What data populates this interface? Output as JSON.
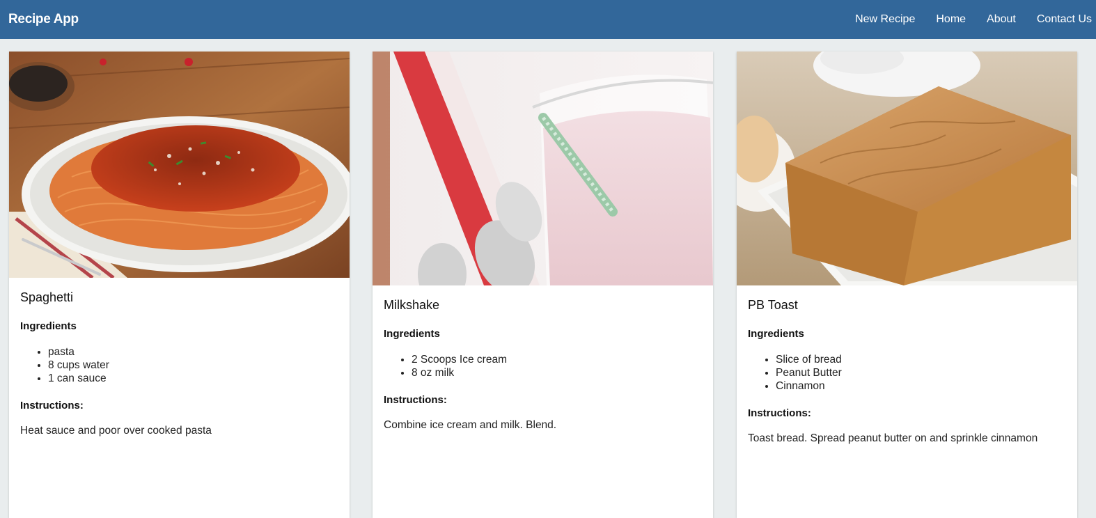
{
  "header": {
    "brand": "Recipe App",
    "nav": [
      "New Recipe",
      "Home",
      "About",
      "Contact Us"
    ]
  },
  "labels": {
    "ingredients": "Ingredients",
    "instructions": "Instructions:"
  },
  "recipes": [
    {
      "title": "Spaghetti",
      "image": "spaghetti-photo",
      "ingredients": [
        "pasta",
        "8 cups water",
        "1 can sauce"
      ],
      "instructions": "Heat sauce and poor over cooked pasta"
    },
    {
      "title": "Milkshake",
      "image": "milkshake-photo",
      "ingredients": [
        "2 Scoops Ice cream",
        "8 oz milk"
      ],
      "instructions": "Combine ice cream and milk. Blend."
    },
    {
      "title": "PB Toast",
      "image": "pb-toast-photo",
      "ingredients": [
        "Slice of bread",
        "Peanut Butter",
        "Cinnamon"
      ],
      "instructions": "Toast bread. Spread peanut butter on and sprinkle cinnamon"
    }
  ],
  "colors": {
    "navbar": "#32679a",
    "background": "#e9edee"
  }
}
